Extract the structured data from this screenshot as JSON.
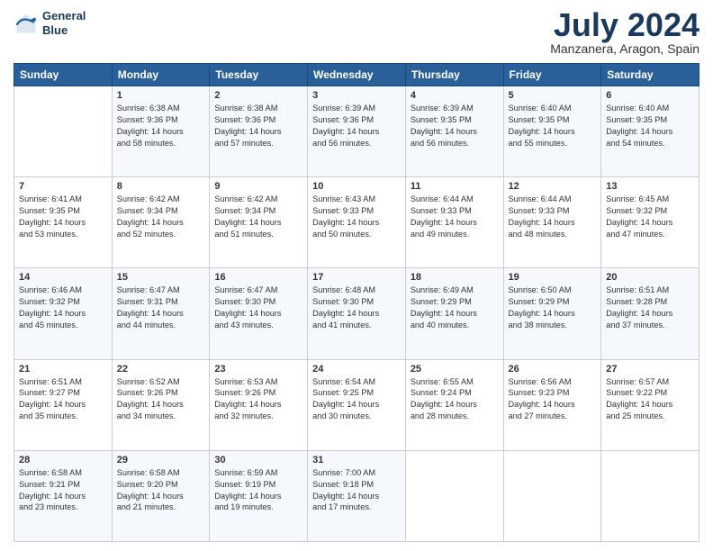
{
  "logo": {
    "line1": "General",
    "line2": "Blue"
  },
  "title": "July 2024",
  "subtitle": "Manzanera, Aragon, Spain",
  "days": [
    "Sunday",
    "Monday",
    "Tuesday",
    "Wednesday",
    "Thursday",
    "Friday",
    "Saturday"
  ],
  "weeks": [
    [
      {
        "day": "",
        "content": ""
      },
      {
        "day": "1",
        "content": "Sunrise: 6:38 AM\nSunset: 9:36 PM\nDaylight: 14 hours\nand 58 minutes."
      },
      {
        "day": "2",
        "content": "Sunrise: 6:38 AM\nSunset: 9:36 PM\nDaylight: 14 hours\nand 57 minutes."
      },
      {
        "day": "3",
        "content": "Sunrise: 6:39 AM\nSunset: 9:36 PM\nDaylight: 14 hours\nand 56 minutes."
      },
      {
        "day": "4",
        "content": "Sunrise: 6:39 AM\nSunset: 9:35 PM\nDaylight: 14 hours\nand 56 minutes."
      },
      {
        "day": "5",
        "content": "Sunrise: 6:40 AM\nSunset: 9:35 PM\nDaylight: 14 hours\nand 55 minutes."
      },
      {
        "day": "6",
        "content": "Sunrise: 6:40 AM\nSunset: 9:35 PM\nDaylight: 14 hours\nand 54 minutes."
      }
    ],
    [
      {
        "day": "7",
        "content": "Sunrise: 6:41 AM\nSunset: 9:35 PM\nDaylight: 14 hours\nand 53 minutes."
      },
      {
        "day": "8",
        "content": "Sunrise: 6:42 AM\nSunset: 9:34 PM\nDaylight: 14 hours\nand 52 minutes."
      },
      {
        "day": "9",
        "content": "Sunrise: 6:42 AM\nSunset: 9:34 PM\nDaylight: 14 hours\nand 51 minutes."
      },
      {
        "day": "10",
        "content": "Sunrise: 6:43 AM\nSunset: 9:33 PM\nDaylight: 14 hours\nand 50 minutes."
      },
      {
        "day": "11",
        "content": "Sunrise: 6:44 AM\nSunset: 9:33 PM\nDaylight: 14 hours\nand 49 minutes."
      },
      {
        "day": "12",
        "content": "Sunrise: 6:44 AM\nSunset: 9:33 PM\nDaylight: 14 hours\nand 48 minutes."
      },
      {
        "day": "13",
        "content": "Sunrise: 6:45 AM\nSunset: 9:32 PM\nDaylight: 14 hours\nand 47 minutes."
      }
    ],
    [
      {
        "day": "14",
        "content": "Sunrise: 6:46 AM\nSunset: 9:32 PM\nDaylight: 14 hours\nand 45 minutes."
      },
      {
        "day": "15",
        "content": "Sunrise: 6:47 AM\nSunset: 9:31 PM\nDaylight: 14 hours\nand 44 minutes."
      },
      {
        "day": "16",
        "content": "Sunrise: 6:47 AM\nSunset: 9:30 PM\nDaylight: 14 hours\nand 43 minutes."
      },
      {
        "day": "17",
        "content": "Sunrise: 6:48 AM\nSunset: 9:30 PM\nDaylight: 14 hours\nand 41 minutes."
      },
      {
        "day": "18",
        "content": "Sunrise: 6:49 AM\nSunset: 9:29 PM\nDaylight: 14 hours\nand 40 minutes."
      },
      {
        "day": "19",
        "content": "Sunrise: 6:50 AM\nSunset: 9:29 PM\nDaylight: 14 hours\nand 38 minutes."
      },
      {
        "day": "20",
        "content": "Sunrise: 6:51 AM\nSunset: 9:28 PM\nDaylight: 14 hours\nand 37 minutes."
      }
    ],
    [
      {
        "day": "21",
        "content": "Sunrise: 6:51 AM\nSunset: 9:27 PM\nDaylight: 14 hours\nand 35 minutes."
      },
      {
        "day": "22",
        "content": "Sunrise: 6:52 AM\nSunset: 9:26 PM\nDaylight: 14 hours\nand 34 minutes."
      },
      {
        "day": "23",
        "content": "Sunrise: 6:53 AM\nSunset: 9:26 PM\nDaylight: 14 hours\nand 32 minutes."
      },
      {
        "day": "24",
        "content": "Sunrise: 6:54 AM\nSunset: 9:25 PM\nDaylight: 14 hours\nand 30 minutes."
      },
      {
        "day": "25",
        "content": "Sunrise: 6:55 AM\nSunset: 9:24 PM\nDaylight: 14 hours\nand 28 minutes."
      },
      {
        "day": "26",
        "content": "Sunrise: 6:56 AM\nSunset: 9:23 PM\nDaylight: 14 hours\nand 27 minutes."
      },
      {
        "day": "27",
        "content": "Sunrise: 6:57 AM\nSunset: 9:22 PM\nDaylight: 14 hours\nand 25 minutes."
      }
    ],
    [
      {
        "day": "28",
        "content": "Sunrise: 6:58 AM\nSunset: 9:21 PM\nDaylight: 14 hours\nand 23 minutes."
      },
      {
        "day": "29",
        "content": "Sunrise: 6:58 AM\nSunset: 9:20 PM\nDaylight: 14 hours\nand 21 minutes."
      },
      {
        "day": "30",
        "content": "Sunrise: 6:59 AM\nSunset: 9:19 PM\nDaylight: 14 hours\nand 19 minutes."
      },
      {
        "day": "31",
        "content": "Sunrise: 7:00 AM\nSunset: 9:18 PM\nDaylight: 14 hours\nand 17 minutes."
      },
      {
        "day": "",
        "content": ""
      },
      {
        "day": "",
        "content": ""
      },
      {
        "day": "",
        "content": ""
      }
    ]
  ]
}
